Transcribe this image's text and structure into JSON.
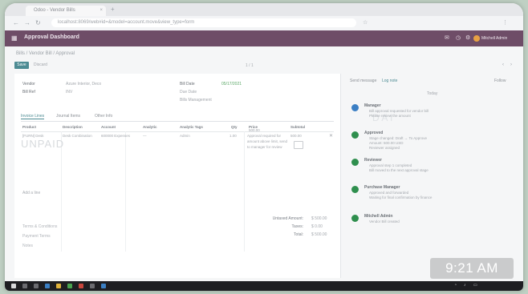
{
  "browser": {
    "tab_title": "Odoo - Vendor Bills",
    "tab_close": "×",
    "new_tab": "+",
    "url": "localhost:8069/web#id=&model=account.move&view_type=form",
    "back": "←",
    "forward": "→",
    "reload": "↻"
  },
  "navbar": {
    "apps_icon": "▦",
    "app_title": "Approval Dashboard",
    "user": "Mitchell Admin"
  },
  "control": {
    "breadcrumb": "Bills / Vendor Bill / Approval",
    "save": "Save",
    "discard": "Discard",
    "pager": "1 / 1",
    "prev": "‹",
    "next": "›"
  },
  "form": {
    "fields_left": [
      {
        "label": "Vendor",
        "value": "Azure Interior, Deco"
      },
      {
        "label": "Bill Ref",
        "value": "INV"
      }
    ],
    "fields_right": [
      {
        "label": "Bill Date",
        "value": "05/17/2021"
      },
      {
        "label": "",
        "value": "Due Date"
      },
      {
        "label": "",
        "value": "Bills Management"
      }
    ],
    "tabs": [
      "Invoice Lines",
      "Journal Items",
      "Other Info"
    ],
    "columns": [
      "Product",
      "Description",
      "Account",
      "Analytic",
      "Analytic Tags",
      "Qty",
      "Price",
      "Subtotal"
    ],
    "line": {
      "product": "[FURN] Desk",
      "description": "Desk Combination",
      "account": "600000 Expenses",
      "analytic": "—",
      "tags": "Admin",
      "qty": "1.00",
      "price": "500.00",
      "subtotal": "500.00",
      "note": "Approval required for amount above limit, send to manager for review"
    },
    "watermark": "UNPAID",
    "add_line": "Add a line",
    "totals": [
      {
        "label": "Untaxed Amount:",
        "value": "$ 500.00"
      },
      {
        "label": "Taxes:",
        "value": "$ 0.00"
      },
      {
        "label": "Total:",
        "value": "$ 500.00"
      }
    ],
    "left_notes": [
      "Terms & Conditions",
      "Payment Terms",
      "Notes"
    ]
  },
  "chatter": {
    "send_message": "Send message",
    "log_note": "Log note",
    "follow": "Follow",
    "date_label": "Today",
    "messages": [
      {
        "author": "Manager",
        "lines": [
          "Bill approval requested for vendor bill",
          "Please review the amount"
        ],
        "color": "#3b7fc4"
      },
      {
        "author": "Approved",
        "lines": [
          "Stage changed: Draft → To Approve",
          "Amount: 500.00 USD",
          "Reviewer assigned"
        ],
        "color": "#2f8f4e"
      },
      {
        "author": "Reviewer",
        "lines": [
          "Approval step 1 completed",
          "Bill moved to the next approval stage"
        ],
        "color": "#2f8f4e"
      },
      {
        "author": "Purchase Manager",
        "lines": [
          "Approved and forwarded",
          "Waiting for final confirmation by finance"
        ],
        "color": "#2f8f4e"
      },
      {
        "author": "Mitchell Admin",
        "lines": [
          "Vendor Bill created"
        ],
        "color": "#2f8f4e"
      }
    ]
  },
  "clock": "9:21 AM",
  "colors": {
    "navbar": "#6e4d67",
    "primary": "#4d8b93",
    "taskbar": "#1e1e22"
  }
}
